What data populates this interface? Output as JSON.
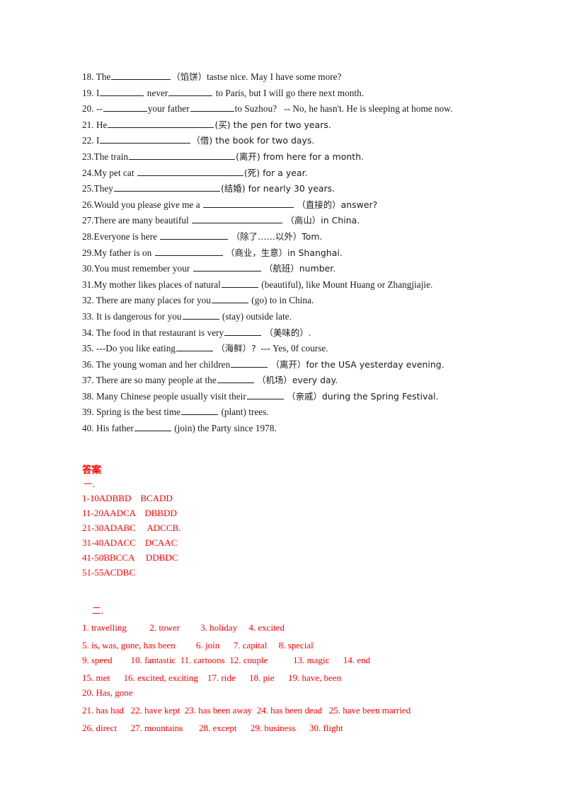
{
  "document": {
    "type": "english-exercise-worksheet",
    "text_color": "#1a1a1a",
    "answer_color": "#ff0000"
  },
  "questions": [
    {
      "n": "18. The",
      "blanks": [
        {
          "size": "b-lg"
        }
      ],
      "parts": [
        "（馅饼）tastse nice. May I have some more?"
      ]
    },
    {
      "n": "19. I",
      "parts": [
        "never",
        "to Paris, but I will go there next month."
      ]
    },
    {
      "n": "20. --",
      "parts": [
        "your father",
        "to Suzhou?    -- No, he hasn't. He is sleeping at home now."
      ]
    },
    {
      "n": "21. He",
      "parts": [
        "(买) the pen for two years."
      ]
    },
    {
      "n": "22. I",
      "parts": [
        "（借) the book for two days."
      ]
    },
    {
      "n": "23.The train",
      "parts": [
        "(离开) from here for a month."
      ]
    },
    {
      "n": "24.My pet cat",
      "parts": [
        "(死) for a year."
      ]
    },
    {
      "n": "25.They",
      "parts": [
        "(结婚) for nearly 30 years."
      ]
    },
    {
      "n": "26.Would you please give me a",
      "parts": [
        "（直接的）answer?"
      ]
    },
    {
      "n": "27.There are many beautiful",
      "parts": [
        "（高山）in China."
      ]
    },
    {
      "n": "28.Everyone is here",
      "parts": [
        "（除了……以外）Tom."
      ]
    },
    {
      "n": "29.My father is on",
      "parts": [
        "（商业，生意）in Shanghai."
      ]
    },
    {
      "n": "30.You must remember your",
      "parts": [
        "（航班）number."
      ]
    },
    {
      "n": "31.My mother likes places of natural",
      "parts": [
        "(beautiful), like Mount Huang or Zhangjiajie."
      ]
    },
    {
      "n": "32. There are many places for you",
      "parts": [
        "(go) to in China."
      ]
    },
    {
      "n": "33. It is dangerous for you",
      "parts": [
        "(stay) outside late."
      ]
    },
    {
      "n": "34. The food in that restaurant is very",
      "parts": [
        "（美味的）."
      ]
    },
    {
      "n": "35. ---Do you like eating",
      "parts": [
        "（海鲜）?   --- Yes, 0f course."
      ]
    },
    {
      "n": "36. The young woman and her children",
      "parts": [
        "（离开）for the USA yesterday evening."
      ]
    },
    {
      "n": "37. There are so many people at the",
      "parts": [
        "（机场）every day."
      ]
    },
    {
      "n": "38. Many Chinese people usually visit their",
      "parts": [
        "（亲戚）during the Spring Festival."
      ]
    },
    {
      "n": "39. Spring is the best time",
      "parts": [
        "(plant) trees."
      ]
    },
    {
      "n": "40. His father",
      "parts": [
        "(join) the Party since 1978."
      ]
    }
  ],
  "q18": {
    "prefix": "18. The",
    "cn": "（馅饼）",
    "suffix": "tastse nice. May I have some more?"
  },
  "q19": {
    "prefix": "19. I",
    "mid": "never",
    "suffix": "to Paris, but I will go there next month."
  },
  "q20": {
    "prefix": "20. --",
    "mid": "your father",
    "suffix": "to Suzhou?",
    "tail": "-- No, he hasn't. He is sleeping at home now."
  },
  "q21": {
    "prefix": "21. He",
    "suffix": "(买) the pen for two years."
  },
  "q22": {
    "prefix": "22. I",
    "suffix": "（借) the book for two days."
  },
  "q23": {
    "prefix": "23.The train",
    "suffix": "(离开) from here for a month."
  },
  "q24": {
    "prefix": "24.My pet cat",
    "suffix": "(死) for a year."
  },
  "q25": {
    "prefix": "25.They",
    "suffix": "(结婚) for nearly 30 years."
  },
  "q26": {
    "prefix": "26.Would you please give me a",
    "suffix": "（直接的）answer?"
  },
  "q27": {
    "prefix": "27.There are many beautiful",
    "suffix": "（高山）in China."
  },
  "q28": {
    "prefix": "28.Everyone is here",
    "suffix": "（除了……以外）Tom."
  },
  "q29": {
    "prefix": "29.My father is on",
    "suffix": "（商业，生意）in Shanghai."
  },
  "q30": {
    "prefix": "30.You must remember your",
    "suffix": "（航班）number."
  },
  "q31": {
    "prefix": "31.My mother likes places of natural",
    "suffix": "(beautiful), like Mount Huang or Zhangjiajie."
  },
  "q32": {
    "prefix": "32. There are many places for you",
    "suffix": "(go) to in China."
  },
  "q33": {
    "prefix": "33. It is dangerous for you",
    "suffix": "(stay) outside late."
  },
  "q34": {
    "prefix": "34. The food in that restaurant is very",
    "suffix": "（美味的）."
  },
  "q35": {
    "prefix": "35. ---Do you like eating",
    "suffix": "（海鲜）?",
    "tail": "--- Yes, 0f course."
  },
  "q36": {
    "prefix": "36. The young woman and her children",
    "suffix": "（离开）for the USA yesterday evening."
  },
  "q37": {
    "prefix": "37. There are so many people at the",
    "suffix": "（机场）every day."
  },
  "q38": {
    "prefix": "38. Many Chinese people usually visit their",
    "suffix": "（亲戚）during the Spring Festival."
  },
  "q39": {
    "prefix": "39. Spring is the best time",
    "suffix": "(plant) trees."
  },
  "q40": {
    "prefix": "40. His father",
    "suffix": "(join) the Party since 1978."
  },
  "answers": {
    "title": "答案",
    "section_one_mark": "一.",
    "section_two_mark": "二.",
    "choice_lines": [
      "1-10ADBBD    BCADD",
      "11-20AADCA    DBBDD",
      "21-30ADABC     ADCCB.",
      "31-40ADACC    DCAAC",
      "41-50BBCCA     DDBDC",
      "51-55ACDBC"
    ],
    "word_lines": [
      "1. travelling          2. tower         3. holiday     4. excited",
      "5. is, was, gone, has been         6. join      7. capital     8. special",
      "9. speed        10. fantastic  11. cartoons  12. couple           13. magic      14. end",
      "15. met      16. excited, exciting    17. ride      18. pie      19. have, been",
      "20. Has, gone",
      "21. has had   22. have kept  23. has been away  24. has been dead   25. have been married",
      "26. direct      27. mountains       28. except      29. business      30. flight"
    ]
  }
}
